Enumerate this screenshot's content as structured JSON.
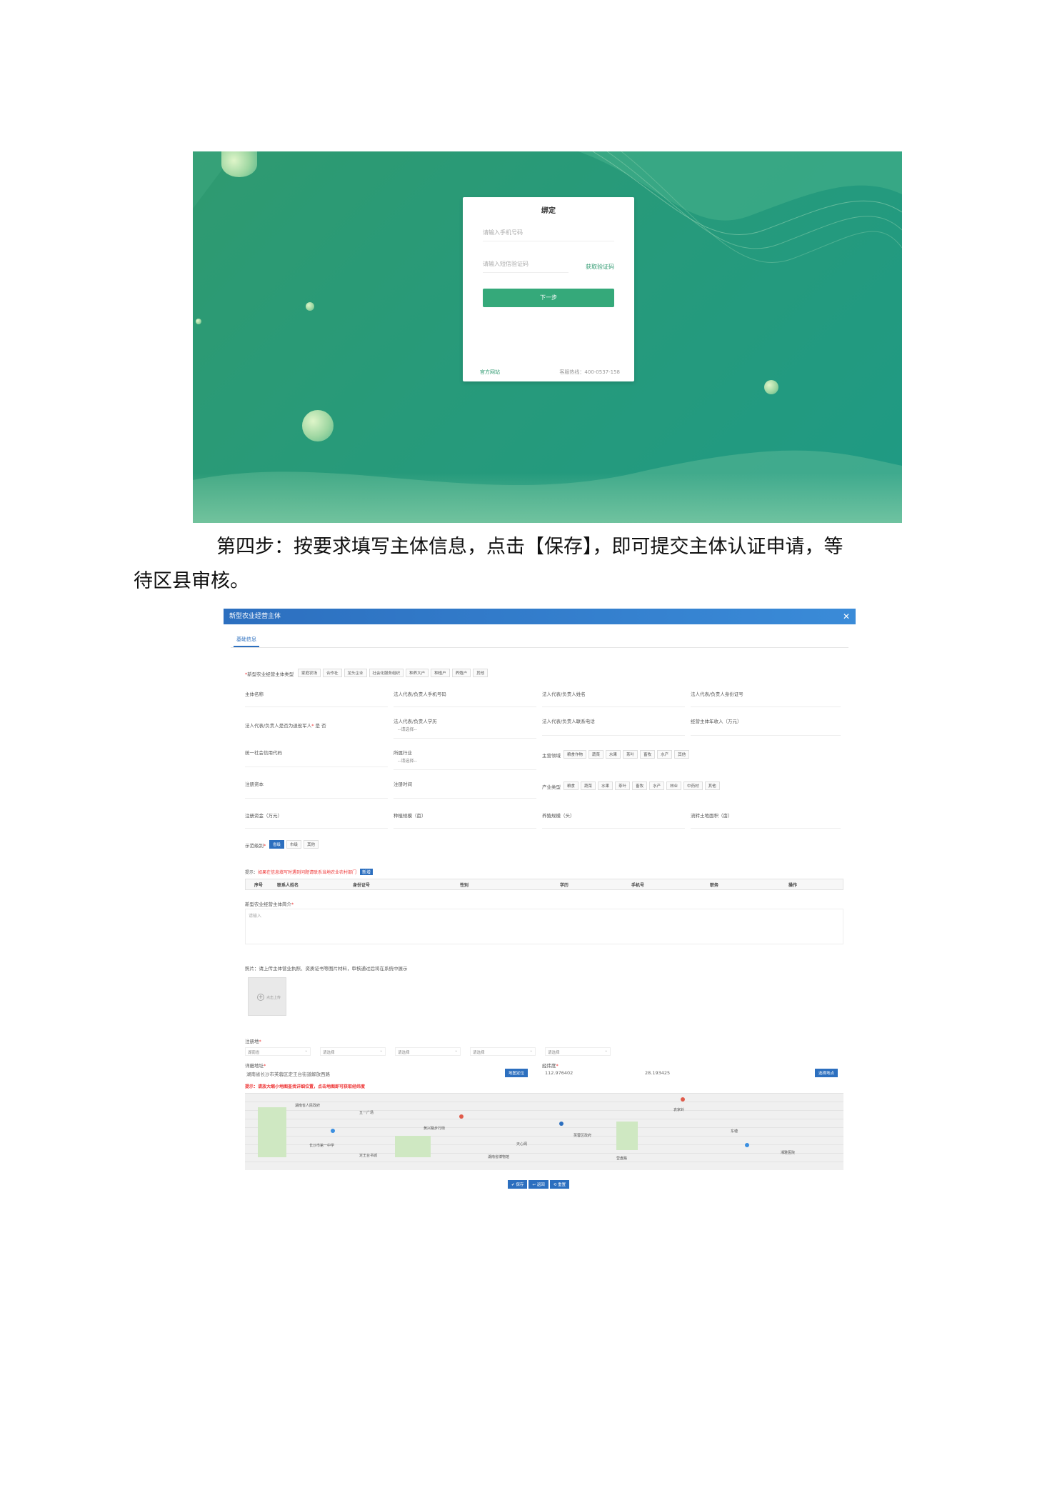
{
  "login": {
    "title": "绑定",
    "phone_placeholder": "请输入手机号码",
    "code_placeholder": "请输入短信验证码",
    "get_code": "获取验证码",
    "next": "下一步",
    "footer_left": "官方网站",
    "footer_right": "客服热线：400-0537-158",
    "accent": "#2f9a70"
  },
  "instruction": {
    "line1": "第四步：按要求填写主体信息，点击【保存】，即可提交主体认证申请，等",
    "line2": "待区县审核。"
  },
  "form": {
    "header_title": "新型农业经营主体",
    "tab": "基础信息",
    "subject_type_label": "新型农业经营主体类型",
    "subject_types": [
      "家庭农场",
      "合作社",
      "龙头企业",
      "社会化服务组织",
      "种养大户",
      "种植户",
      "养殖户",
      "其他"
    ],
    "selected_subject_type": "",
    "row1": [
      "主体名称",
      "法人代表/负责人手机号码",
      "法人代表/负责人姓名",
      "法人代表/负责人身份证号"
    ],
    "row2": [
      "法人代表/负责人是否为退役军人",
      "法人代表/负责人学历",
      "法人代表/负责人联系电话",
      "经营主体年收入（万元）"
    ],
    "row2_radio": [
      "是",
      "否"
    ],
    "row3": [
      "统一社会信用代码",
      "所属行业",
      "主营领域"
    ],
    "row3_chips": [
      "粮食作物",
      "蔬菜",
      "水果",
      "茶叶",
      "畜牧",
      "水产",
      "其他"
    ],
    "row4": [
      "注册资本",
      "注册时间",
      "产业类型"
    ],
    "row4_chips": [
      "粮食",
      "蔬菜",
      "水果",
      "茶叶",
      "畜牧",
      "水产",
      "林业",
      "中药材",
      "其他"
    ],
    "row5": [
      "注册资金（万元）",
      "种植规模（亩）",
      "养殖规模（头）",
      "流转土地面积（亩）"
    ],
    "select_placeholder": "--请选择--",
    "level_label": "示范级别",
    "level_options": [
      "省级",
      "市级",
      "其他"
    ],
    "level_selected": "省级",
    "notice_lead": "提示：",
    "notice_text": "如果在信息填写时遇到问题请联系当地农业农村部门",
    "notice_btn": "新增",
    "table_headers": [
      "序号",
      "联系人姓名",
      "身份证号",
      "性别",
      "学历",
      "手机号",
      "职务",
      "操作"
    ],
    "intro_label": "新型农业经营主体简介",
    "intro_placeholder": "请输入",
    "upload_label": "照片：请上传主体营业执照、资质证书等图片材料，审核通过后将在系统中展示",
    "upload_text": "点击上传",
    "address_label": "注册地",
    "address_selects": [
      "湖南省",
      "请选择",
      "请选择",
      "请选择",
      "请选择"
    ],
    "detail_address_label": "详细地址",
    "detail_address_value": "湖南省长沙市芙蓉区定王台街道解放西路",
    "locate_btn": "地图定位",
    "coords_label": "经纬度",
    "longitude": "112.976402",
    "latitude": "28.193425",
    "pick_btn": "选择地点",
    "map_warning": "提示：请放大缩小地图查找详细位置，点击地图即可获取经纬度",
    "map_labels": [
      "湖南省人民政府",
      "五一广场",
      "黄兴路步行街",
      "长沙市第一中学",
      "定王台书城",
      "袁家岭",
      "芙蓉区政府",
      "湖南省博物馆",
      "天心阁",
      "东塘",
      "湘雅医院",
      "营盘路"
    ],
    "actions": [
      "保存",
      "返回",
      "重置"
    ]
  }
}
